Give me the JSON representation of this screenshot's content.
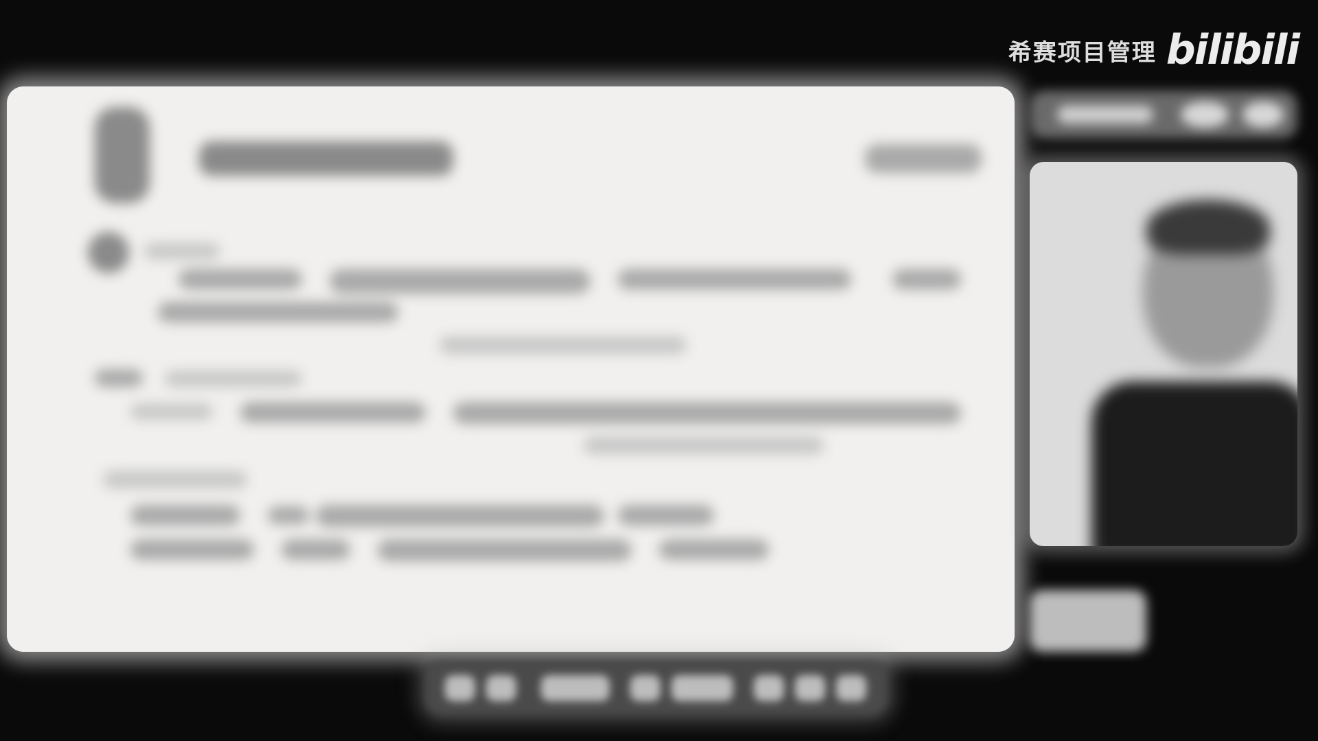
{
  "watermark": {
    "channel_name": "希赛项目管理",
    "logo_text": "bilibili"
  },
  "document": {
    "state": "blurred"
  },
  "webcam": {
    "state": "presenter-video"
  },
  "taskbar": {
    "state": "blurred"
  }
}
